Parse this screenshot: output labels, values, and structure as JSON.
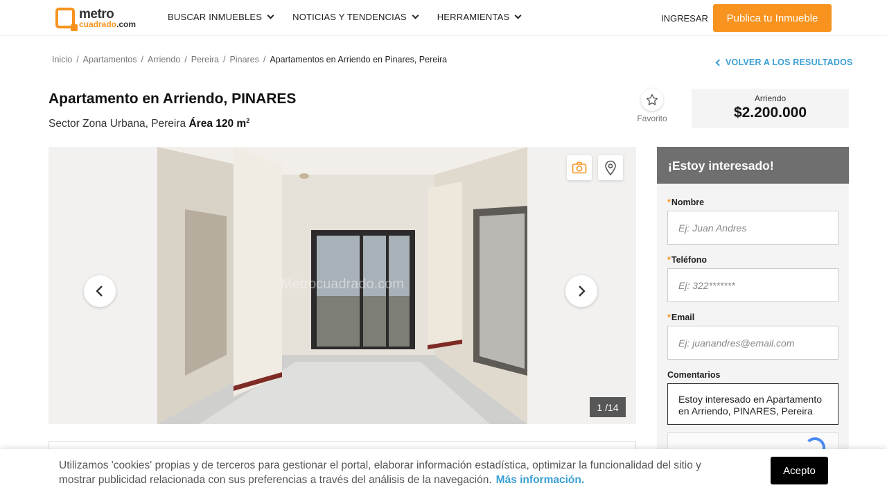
{
  "header": {
    "logo_top": "metro",
    "logo_bottom": "cuadrado",
    "logo_suffix": ".com",
    "nav": [
      {
        "label": "BUSCAR INMUEBLES"
      },
      {
        "label": "NOTICIAS Y TENDENCIAS"
      },
      {
        "label": "HERRAMIENTAS"
      }
    ],
    "login": "INGRESAR",
    "publish": "Publica tu Inmueble"
  },
  "breadcrumb": {
    "items": [
      "Inicio",
      "Apartamentos",
      "Arriendo",
      "Pereira",
      "Pinares"
    ],
    "current": "Apartamentos en Arriendo en Pinares, Pereira",
    "separator": "/",
    "back": "VOLVER A LOS RESULTADOS"
  },
  "listing": {
    "title": "Apartamento en Arriendo, PINARES",
    "location": "Sector Zona Urbana, Pereira",
    "area_label": "Área 120 m",
    "area_sup": "2",
    "favorite": "Favorito",
    "price_type": "Arriendo",
    "price": "$2.200.000"
  },
  "gallery": {
    "watermark": "Metrocuadrado.com",
    "counter": "1 /14"
  },
  "form": {
    "heading": "¡Estoy interesado!",
    "req_mark": "*",
    "name_label": "Nombre",
    "name_placeholder": "Ej: Juan Andres",
    "phone_label": "Teléfono",
    "phone_placeholder": "Ej: 322*******",
    "email_label": "Email",
    "email_placeholder": "Ej: juanandres@email.com",
    "comments_label": "Comentarios",
    "comments_value": "Estoy interesado en Apartamento en Arriendo, PINARES, Pereira"
  },
  "cookie": {
    "text": "Utilizamos 'cookies' propias y de terceros para gestionar el portal, elaborar información estadística, optimizar la funcionalidad del sitio y mostrar publicidad relacionada con sus preferencias a través del análisis de la navegación.",
    "link": "Más información.",
    "accept": "Acepto"
  },
  "colors": {
    "brand_orange": "#f7931e",
    "link_blue": "#3a9fd5",
    "form_header": "#6f6f6f"
  }
}
